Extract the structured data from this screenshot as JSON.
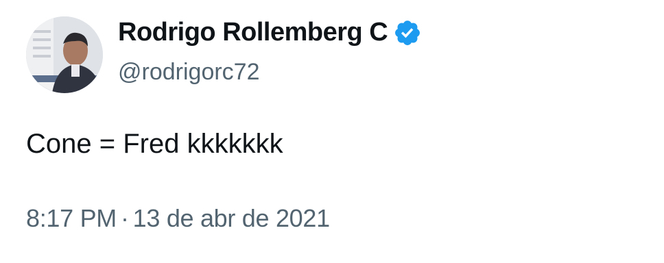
{
  "author": {
    "display_name": "Rodrigo Rollemberg C",
    "handle": "@rodrigorc72",
    "verified_icon": "verified-badge-icon",
    "verified_color": "#1d9bf0"
  },
  "tweet": {
    "text": "Cone = Fred kkkkkkk",
    "time": "8:17 PM",
    "separator": "·",
    "date": "13 de abr de 2021"
  },
  "colors": {
    "primary_text": "#0f1419",
    "secondary_text": "#536471"
  }
}
